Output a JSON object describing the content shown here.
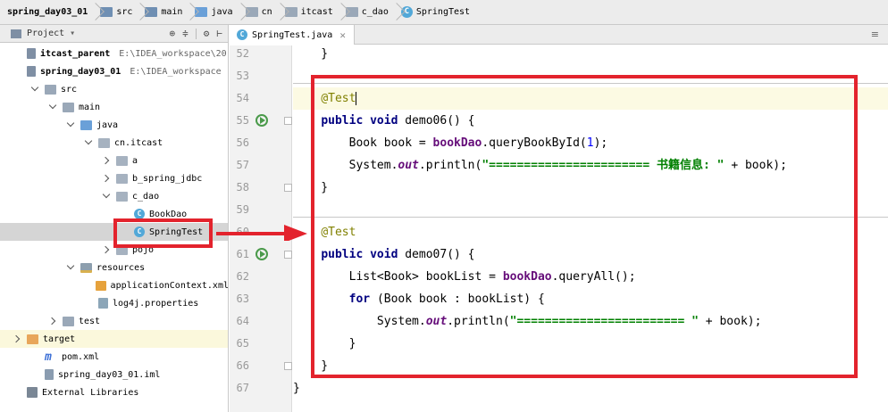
{
  "breadcrumb": [
    {
      "label": "spring_day03_01",
      "icon": "project-icon"
    },
    {
      "label": "src",
      "icon": "folder-icon"
    },
    {
      "label": "main",
      "icon": "folder-icon"
    },
    {
      "label": "java",
      "icon": "source-folder-icon"
    },
    {
      "label": "cn",
      "icon": "package-icon"
    },
    {
      "label": "itcast",
      "icon": "package-icon"
    },
    {
      "label": "c_dao",
      "icon": "package-icon"
    },
    {
      "label": "SpringTest",
      "icon": "class-icon"
    }
  ],
  "project_panel": {
    "title": "Project",
    "tree": [
      {
        "label": "itcast_parent",
        "path": "E:\\IDEA_workspace\\20",
        "bold": true,
        "indent": 0,
        "arrow": "none",
        "icon": "module"
      },
      {
        "label": "spring_day03_01",
        "path": "E:\\IDEA_workspace",
        "bold": true,
        "indent": 0,
        "arrow": "none",
        "icon": "module"
      },
      {
        "label": "src",
        "indent": 1,
        "arrow": "down",
        "icon": "folder"
      },
      {
        "label": "main",
        "indent": 2,
        "arrow": "down",
        "icon": "folder"
      },
      {
        "label": "java",
        "indent": 3,
        "arrow": "down",
        "icon": "java"
      },
      {
        "label": "cn.itcast",
        "indent": 4,
        "arrow": "down",
        "icon": "pkg"
      },
      {
        "label": "a",
        "indent": 5,
        "arrow": "right",
        "icon": "pkg"
      },
      {
        "label": "b_spring_jdbc",
        "indent": 5,
        "arrow": "right",
        "icon": "pkg"
      },
      {
        "label": "c_dao",
        "indent": 5,
        "arrow": "down",
        "icon": "pkg"
      },
      {
        "label": "BookDao",
        "indent": 6,
        "arrow": "none",
        "icon": "cls"
      },
      {
        "label": "SpringTest",
        "indent": 6,
        "arrow": "none",
        "icon": "cls",
        "selected": true
      },
      {
        "label": "pojo",
        "indent": 5,
        "arrow": "right",
        "icon": "pkg"
      },
      {
        "label": "resources",
        "indent": 3,
        "arrow": "down",
        "icon": "res"
      },
      {
        "label": "applicationContext.xml",
        "indent": 4,
        "arrow": "none",
        "icon": "xml"
      },
      {
        "label": "log4j.properties",
        "indent": 4,
        "arrow": "none",
        "icon": "props"
      },
      {
        "label": "test",
        "indent": 2,
        "arrow": "right",
        "icon": "folder"
      },
      {
        "label": "target",
        "indent": 0,
        "arrow": "right",
        "icon": "target",
        "highlight": true
      },
      {
        "label": "pom.xml",
        "indent": 1,
        "arrow": "none",
        "icon": "mvn"
      },
      {
        "label": "spring_day03_01.iml",
        "indent": 1,
        "arrow": "none",
        "icon": "iml"
      },
      {
        "label": "External Libraries",
        "indent": 0,
        "arrow": "none",
        "icon": "libs"
      }
    ]
  },
  "editor": {
    "tab_label": "SpringTest.java",
    "lines": [
      {
        "n": "52",
        "tokens": [
          [
            "pl",
            "    }"
          ]
        ]
      },
      {
        "n": "53",
        "tokens": []
      },
      {
        "n": "54",
        "current": true,
        "tokens": [
          [
            "pl",
            "    "
          ],
          [
            "ann",
            "@Test"
          ],
          [
            "caret",
            ""
          ]
        ]
      },
      {
        "n": "55",
        "run": true,
        "fold": true,
        "tokens": [
          [
            "pl",
            "    "
          ],
          [
            "kw",
            "public void "
          ],
          [
            "pl",
            "demo06() {"
          ]
        ]
      },
      {
        "n": "56",
        "tokens": [
          [
            "pl",
            "        Book book = "
          ],
          [
            "field",
            "bookDao"
          ],
          [
            "pl",
            ".queryBookById("
          ],
          [
            "num",
            "1"
          ],
          [
            "pl",
            ");"
          ]
        ]
      },
      {
        "n": "57",
        "tokens": [
          [
            "pl",
            "        System."
          ],
          [
            "static",
            "out"
          ],
          [
            "pl",
            ".println("
          ],
          [
            "str",
            "\"======================= 书籍信息: \""
          ],
          [
            "pl",
            " + book);"
          ]
        ]
      },
      {
        "n": "58",
        "fold": true,
        "tokens": [
          [
            "pl",
            "    }"
          ]
        ]
      },
      {
        "n": "59",
        "tokens": []
      },
      {
        "n": "60",
        "tokens": [
          [
            "pl",
            "    "
          ],
          [
            "ann",
            "@Test"
          ]
        ]
      },
      {
        "n": "61",
        "run": true,
        "fold": true,
        "tokens": [
          [
            "pl",
            "    "
          ],
          [
            "kw",
            "public void "
          ],
          [
            "pl",
            "demo07() {"
          ]
        ]
      },
      {
        "n": "62",
        "tokens": [
          [
            "pl",
            "        List<Book> bookList = "
          ],
          [
            "field",
            "bookDao"
          ],
          [
            "pl",
            ".queryAll();"
          ]
        ]
      },
      {
        "n": "63",
        "tokens": [
          [
            "pl",
            "        "
          ],
          [
            "kw",
            "for "
          ],
          [
            "pl",
            "(Book book : bookList) {"
          ]
        ]
      },
      {
        "n": "64",
        "tokens": [
          [
            "pl",
            "            System."
          ],
          [
            "static",
            "out"
          ],
          [
            "pl",
            ".println("
          ],
          [
            "str",
            "\"======================== \""
          ],
          [
            "pl",
            " + book);"
          ]
        ]
      },
      {
        "n": "65",
        "tokens": [
          [
            "pl",
            "        }"
          ]
        ]
      },
      {
        "n": "66",
        "fold": true,
        "tokens": [
          [
            "pl",
            "    }"
          ]
        ]
      },
      {
        "n": "67",
        "tokens": [
          [
            "pl",
            "}"
          ]
        ]
      }
    ]
  },
  "colors": {
    "annotation_red": "#e3232d",
    "keyword": "#000080",
    "string": "#008000",
    "field": "#660e7a",
    "number": "#0000ff",
    "annotation": "#808000"
  }
}
